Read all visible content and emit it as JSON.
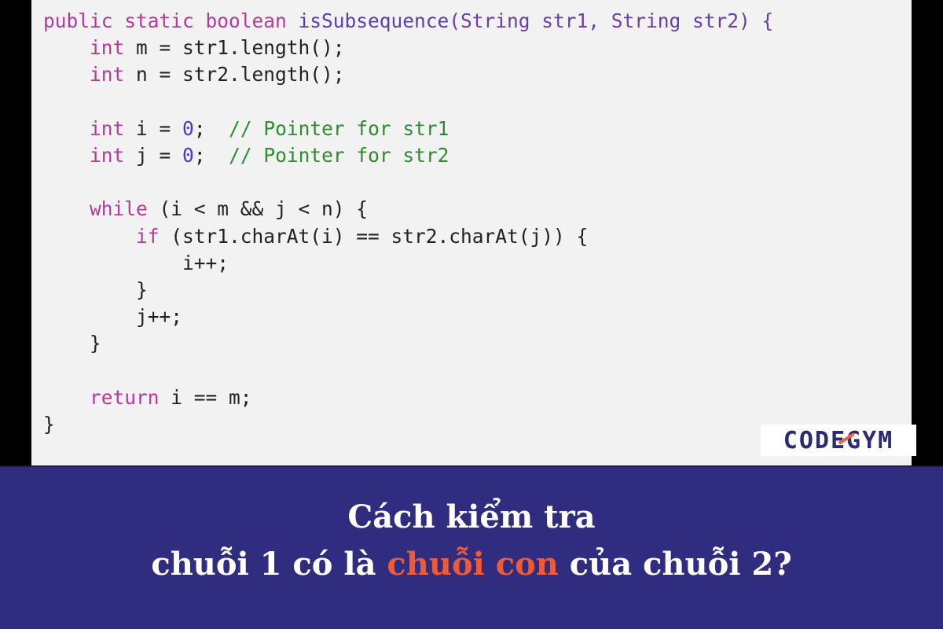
{
  "code_panel": {
    "lines": [
      [
        {
          "t": "public static boolean ",
          "c": "keyword"
        },
        {
          "t": "isSubsequence",
          "c": "func"
        },
        {
          "t": "(String str1, String str2) {",
          "c": "type"
        }
      ],
      [
        {
          "t": "    ",
          "c": "plain"
        },
        {
          "t": "int",
          "c": "keyword"
        },
        {
          "t": " m = str1.length();",
          "c": "plain"
        }
      ],
      [
        {
          "t": "    ",
          "c": "plain"
        },
        {
          "t": "int",
          "c": "keyword"
        },
        {
          "t": " n = str2.length();",
          "c": "plain"
        }
      ],
      [],
      [
        {
          "t": "    ",
          "c": "plain"
        },
        {
          "t": "int",
          "c": "keyword"
        },
        {
          "t": " i = ",
          "c": "plain"
        },
        {
          "t": "0",
          "c": "number"
        },
        {
          "t": ";  ",
          "c": "plain"
        },
        {
          "t": "// Pointer for str1",
          "c": "comment"
        }
      ],
      [
        {
          "t": "    ",
          "c": "plain"
        },
        {
          "t": "int",
          "c": "keyword"
        },
        {
          "t": " j = ",
          "c": "plain"
        },
        {
          "t": "0",
          "c": "number"
        },
        {
          "t": ";  ",
          "c": "plain"
        },
        {
          "t": "// Pointer for str2",
          "c": "comment"
        }
      ],
      [],
      [
        {
          "t": "    ",
          "c": "plain"
        },
        {
          "t": "while",
          "c": "keyword"
        },
        {
          "t": " (i < m && j < n) {",
          "c": "plain"
        }
      ],
      [
        {
          "t": "        ",
          "c": "plain"
        },
        {
          "t": "if",
          "c": "keyword"
        },
        {
          "t": " (str1.charAt(i) == str2.charAt(j)) {",
          "c": "plain"
        }
      ],
      [
        {
          "t": "            i++;",
          "c": "plain"
        }
      ],
      [
        {
          "t": "        }",
          "c": "plain"
        }
      ],
      [
        {
          "t": "        j++;",
          "c": "plain"
        }
      ],
      [
        {
          "t": "    }",
          "c": "plain"
        }
      ],
      [],
      [
        {
          "t": "    ",
          "c": "plain"
        },
        {
          "t": "return",
          "c": "keyword"
        },
        {
          "t": " i == m;",
          "c": "plain"
        }
      ],
      [
        {
          "t": "}",
          "c": "plain"
        }
      ]
    ]
  },
  "logo": {
    "text": "CODEGYM",
    "brand_color": "#2b2b75",
    "accent_color": "#e8643a"
  },
  "banner": {
    "background": "#302d80",
    "line1": "Cách kiểm tra",
    "line2_before": "chuỗi 1 có là ",
    "line2_highlight": "chuỗi con",
    "line2_after": " của chuỗi 2?",
    "highlight_color": "#ee5a36"
  }
}
